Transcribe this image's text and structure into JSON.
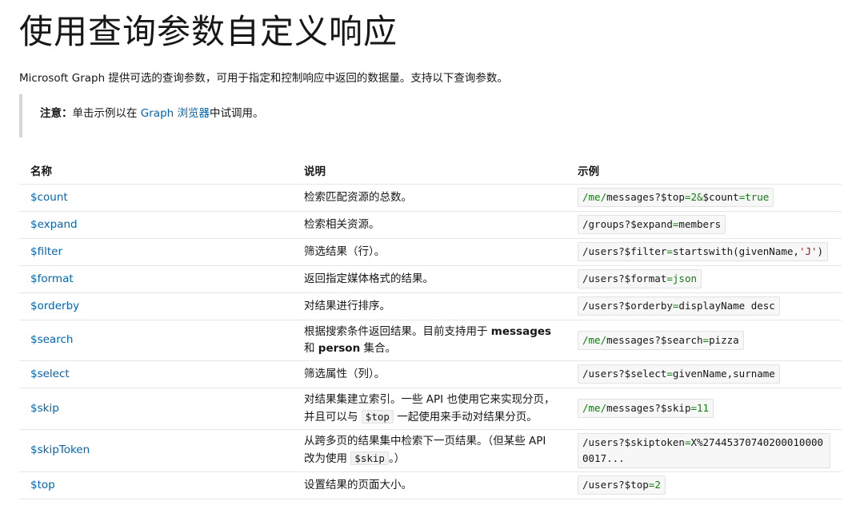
{
  "title": "使用查询参数自定义响应",
  "intro": "Microsoft Graph 提供可选的查询参数，可用于指定和控制响应中返回的数据量。支持以下查询参数。",
  "note": {
    "label": "注意：",
    "before": "单击示例以在 ",
    "link": "Graph 浏览器",
    "after": "中试调用。"
  },
  "table": {
    "headers": [
      "名称",
      "说明",
      "示例"
    ],
    "rows": [
      {
        "name": "$count",
        "desc": "检索匹配资源的总数。",
        "example": "/me/messages?$top=2&$count=true"
      },
      {
        "name": "$expand",
        "desc": "检索相关资源。",
        "example": "/groups?$expand=members"
      },
      {
        "name": "$filter",
        "desc": "筛选结果（行）。",
        "example": "/users?$filter=startswith(givenName,'J')"
      },
      {
        "name": "$format",
        "desc": "返回指定媒体格式的结果。",
        "example": "/users?$format=json"
      },
      {
        "name": "$orderby",
        "desc": "对结果进行排序。",
        "example": "/users?$orderby=displayName desc"
      },
      {
        "name": "$search",
        "desc_parts": [
          "根据搜索条件返回结果。目前支持用于 ",
          "messages",
          " 和 ",
          "person",
          " 集合。"
        ],
        "example": "/me/messages?$search=pizza"
      },
      {
        "name": "$select",
        "desc": "筛选属性（列）。",
        "example": "/users?$select=givenName,surname"
      },
      {
        "name": "$skip",
        "desc_parts": [
          "对结果集建立索引。一些 API 也使用它来实现分页，并且可以与 ",
          "$top",
          " 一起使用来手动对结果分页。"
        ],
        "example": "/me/messages?$skip=11"
      },
      {
        "name": "$skipToken",
        "desc_parts": [
          "从跨多页的结果集中检索下一页结果。（但某些 API 改为使用 ",
          "$skip",
          "。）"
        ],
        "example": "/users?$skiptoken=X%274453707402000100000017..."
      },
      {
        "name": "$top",
        "desc": "设置结果的页面大小。",
        "example": "/users?$top=2"
      }
    ]
  }
}
